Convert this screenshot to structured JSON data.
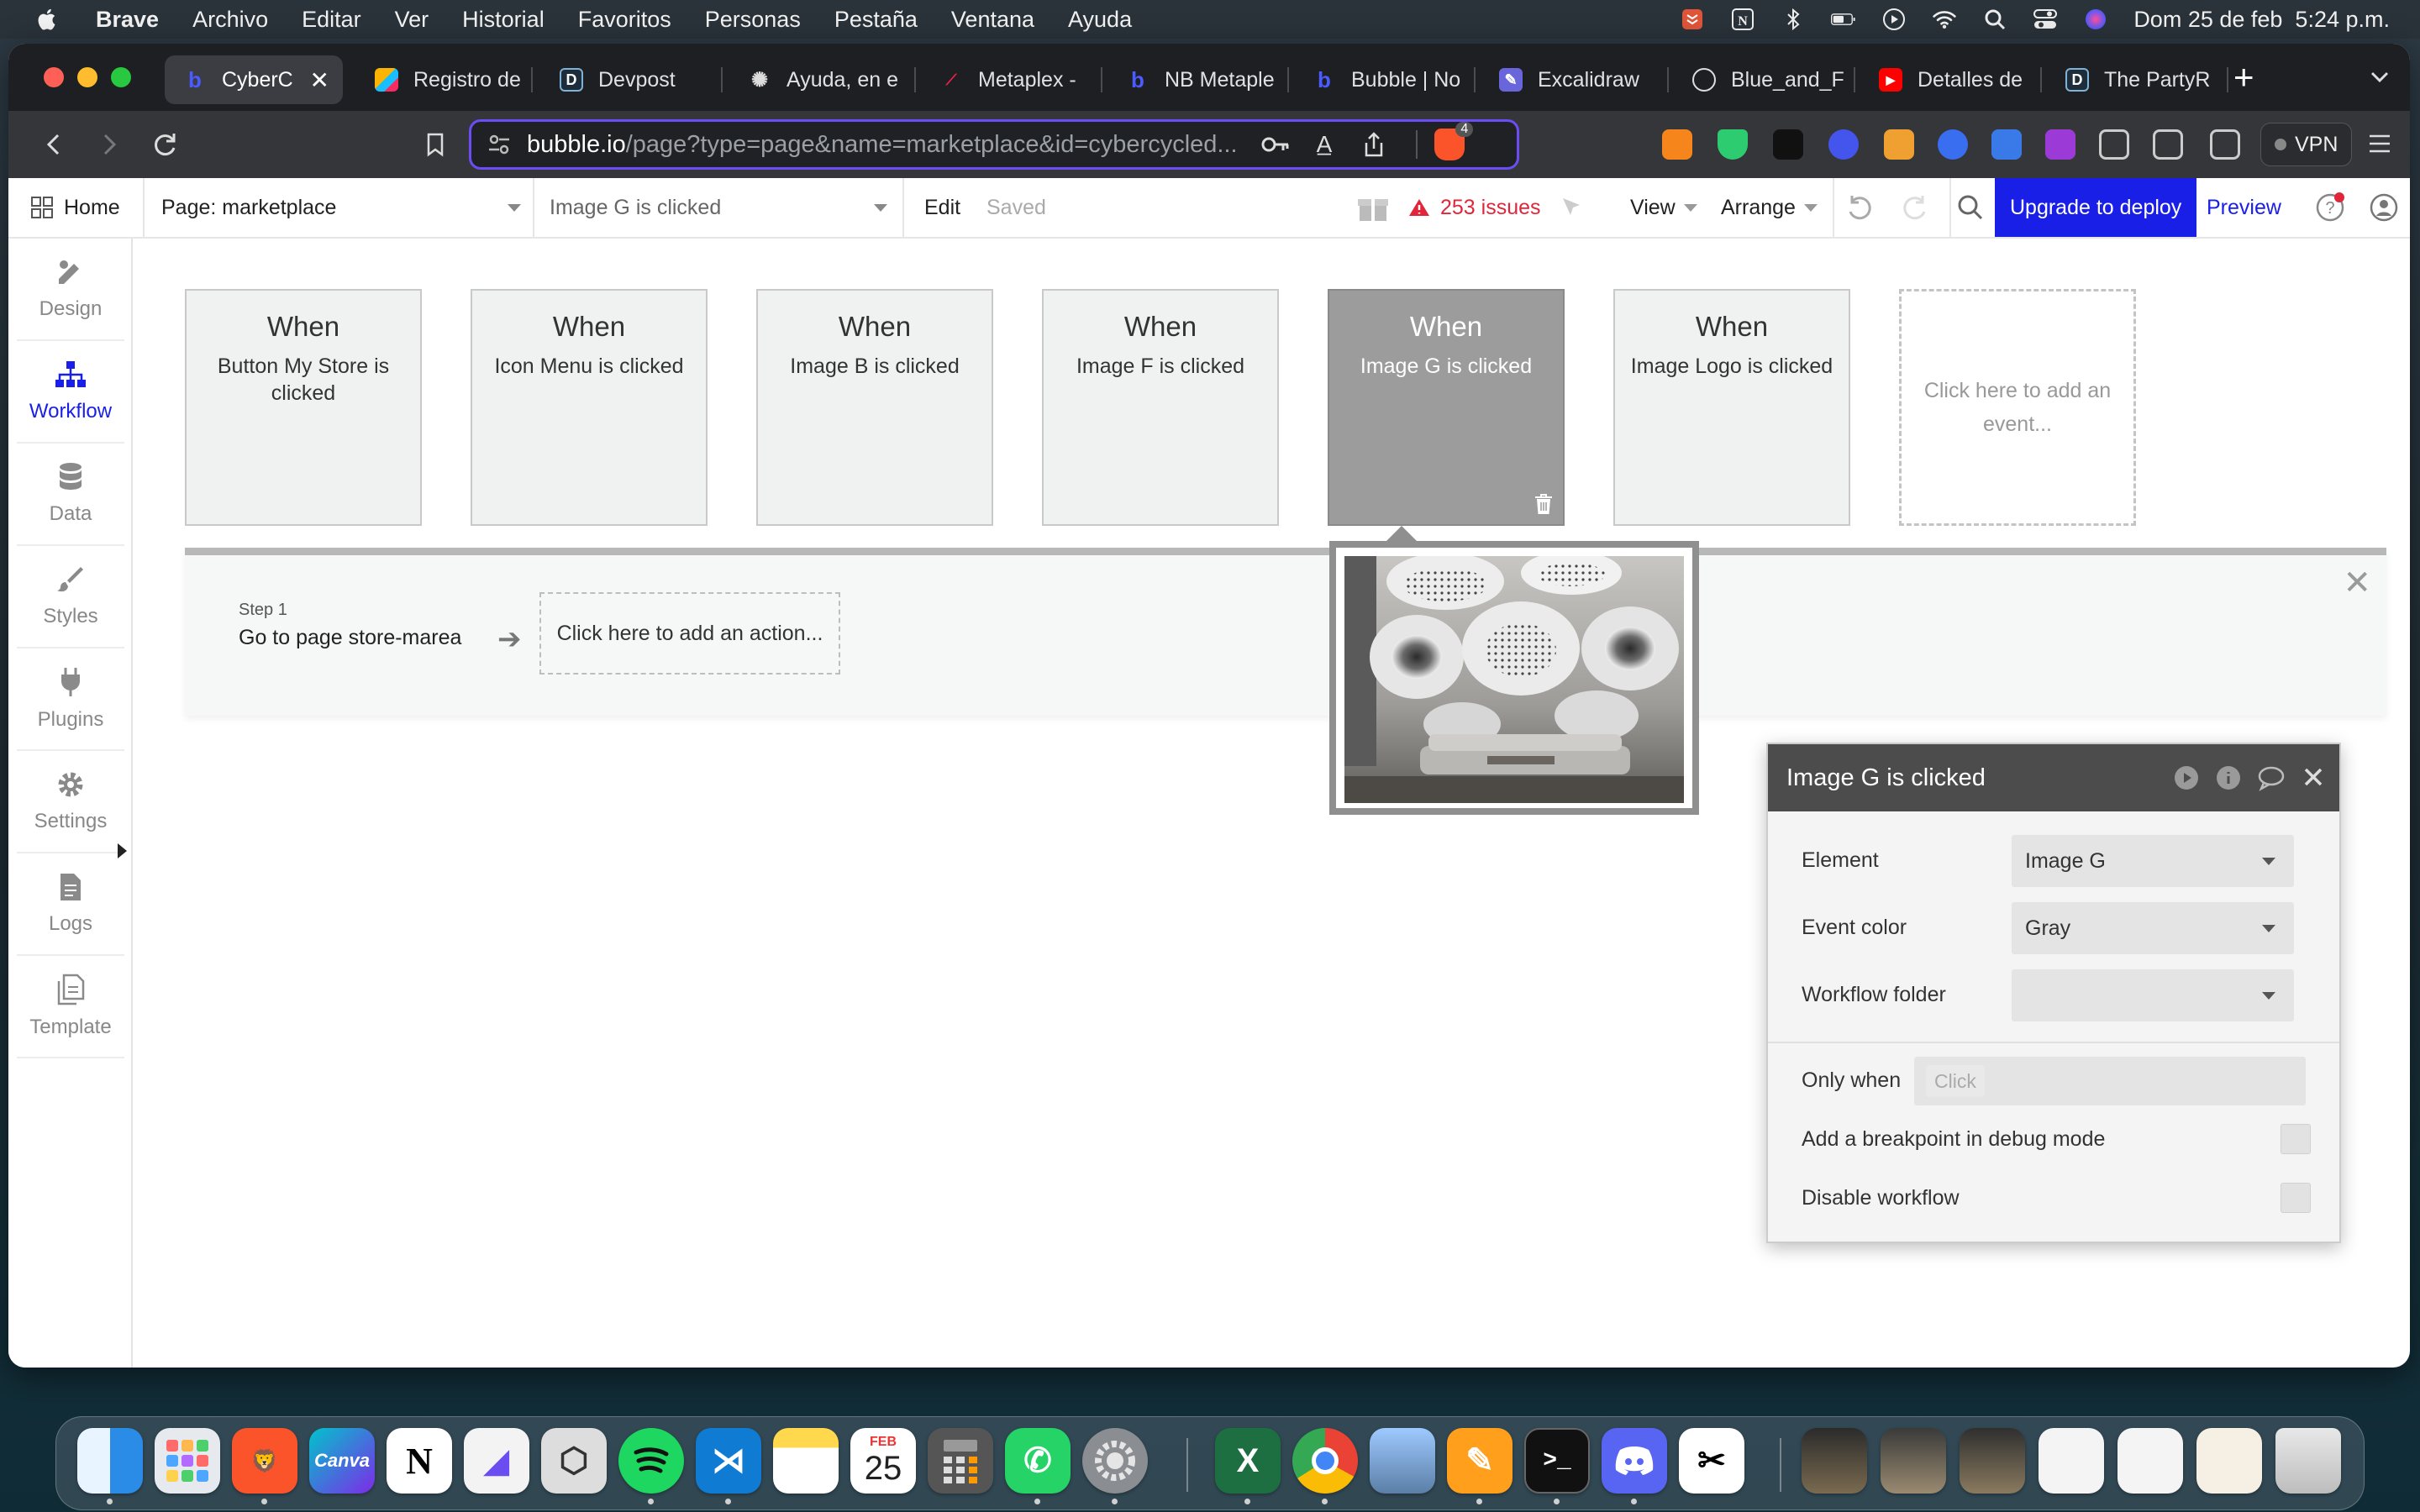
{
  "menubar": {
    "app_name": "Brave",
    "items": [
      "Archivo",
      "Editar",
      "Ver",
      "Historial",
      "Favoritos",
      "Personas",
      "Pestaña",
      "Ventana",
      "Ayuda"
    ],
    "clock": "Dom 25 de feb  5:24 p.m."
  },
  "tabs": [
    {
      "label": "CyberC",
      "icon": "bubble-icon",
      "active": true
    },
    {
      "label": "Registro de",
      "icon": "airtable-icon"
    },
    {
      "label": "Devpost",
      "icon": "devpost-icon"
    },
    {
      "label": "Ayuda, en e",
      "icon": "help-icon"
    },
    {
      "label": "Metaplex -",
      "icon": "metaplex-icon"
    },
    {
      "label": "NB Metaple",
      "icon": "bubble-icon"
    },
    {
      "label": "Bubble | No",
      "icon": "bubble-icon"
    },
    {
      "label": "Excalidraw",
      "icon": "excalidraw-icon"
    },
    {
      "label": "Blue_and_F",
      "icon": "globe-icon"
    },
    {
      "label": "Detalles de",
      "icon": "youtube-icon"
    },
    {
      "label": "The PartyR",
      "icon": "devpost-icon"
    }
  ],
  "address_bar": {
    "host": "bubble.io",
    "path": "/page?type=page&name=marketplace&id=cybercycled..."
  },
  "extensions": {
    "brave_badge": "4",
    "vpn_label": "VPN"
  },
  "bubble_header": {
    "home_label": "Home",
    "page_select": "Page: marketplace",
    "workflow_select": "Image G is clicked",
    "edit_label": "Edit",
    "saved_label": "Saved",
    "issues_label": "253 issues",
    "view_label": "View",
    "arrange_label": "Arrange",
    "upgrade_label": "Upgrade to deploy",
    "preview_label": "Preview"
  },
  "sidebar": {
    "items": [
      {
        "label": "Design",
        "icon": "design-icon"
      },
      {
        "label": "Workflow",
        "icon": "workflow-icon",
        "active": true
      },
      {
        "label": "Data",
        "icon": "database-icon"
      },
      {
        "label": "Styles",
        "icon": "brush-icon"
      },
      {
        "label": "Plugins",
        "icon": "plug-icon"
      },
      {
        "label": "Settings",
        "icon": "gear-icon"
      },
      {
        "label": "Logs",
        "icon": "document-icon"
      },
      {
        "label": "Template",
        "icon": "template-icon"
      }
    ]
  },
  "events": [
    {
      "when": "When",
      "label": "Button My Store is clicked"
    },
    {
      "when": "When",
      "label": "Icon Menu is clicked"
    },
    {
      "when": "When",
      "label": "Image B is clicked"
    },
    {
      "when": "When",
      "label": "Image F is clicked"
    },
    {
      "when": "When",
      "label": "Image G is clicked",
      "selected": true
    },
    {
      "when": "When",
      "label": "Image Logo is clicked"
    }
  ],
  "add_event_label": "Click here to add an event...",
  "steps": {
    "step_number": "Step 1",
    "step_label": "Go to page store-marea",
    "add_action_label": "Click here to add an action..."
  },
  "property_editor": {
    "title": "Image G is clicked",
    "element_label": "Element",
    "element_value": "Image G",
    "event_color_label": "Event color",
    "event_color_value": "Gray",
    "workflow_folder_label": "Workflow folder",
    "workflow_folder_value": "",
    "only_when_label": "Only when",
    "only_when_token": "Click",
    "breakpoint_label": "Add a breakpoint in debug mode",
    "disable_label": "Disable workflow"
  },
  "dock": {
    "apps": [
      "finder-icon",
      "launchpad-icon",
      "brave-icon",
      "canva-icon",
      "notion-icon",
      "affinity-icon",
      "unity-icon",
      "spotify-icon",
      "vscode-icon",
      "notes-icon",
      "calendar-icon",
      "calculator-icon",
      "whatsapp-icon",
      "system-settings-icon",
      "excel-icon",
      "chrome-icon",
      "preview-icon",
      "pages-icon",
      "terminal-icon",
      "discord-icon",
      "capcut-icon"
    ],
    "calendar_month": "FEB",
    "calendar_day": "25"
  },
  "colors": {
    "bubble_blue": "#1a1fe8",
    "issues_red": "#e0263b",
    "selected_event": "#9c9c9c"
  }
}
